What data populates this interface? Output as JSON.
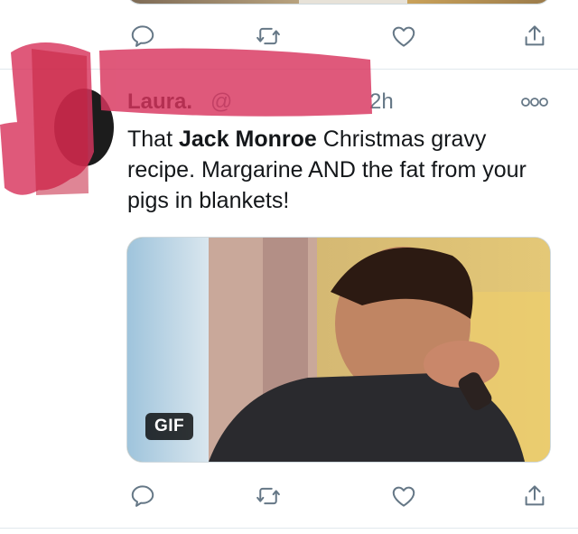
{
  "prev_tweet": {
    "actions": [
      "reply-icon",
      "retweet-icon",
      "like-icon",
      "share-icon"
    ]
  },
  "tweet": {
    "author_name": "Laura.",
    "handle": "@",
    "time": "2h",
    "text_before": "That ",
    "text_bold": "Jack Monroe",
    "text_after": " Christmas gravy recipe. Margarine AND the fat from your pigs in blankets!",
    "media_badge": "GIF",
    "actions": [
      "reply-icon",
      "retweet-icon",
      "like-icon",
      "share-icon"
    ]
  },
  "colors": {
    "text": "#14171a",
    "secondary": "#657786",
    "divider": "#e1e8ed",
    "redaction": "#d8355e"
  }
}
